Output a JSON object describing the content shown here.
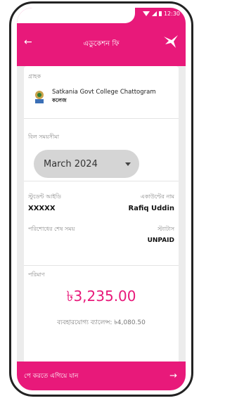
{
  "statusbar": {
    "time": "12:30"
  },
  "header": {
    "title": "এডুকেশন ফি",
    "back_icon": "arrow-left-icon",
    "logo_icon": "bird-logo-icon"
  },
  "institution": {
    "label": "গ্রাহক",
    "name": "Satkania Govt College Chattogram",
    "subname": "কলেজ"
  },
  "bill_period": {
    "label": "বিল সময়সীমা",
    "selected": "March 2024"
  },
  "student": {
    "id_label": "স্টুডেন্ট আইডি",
    "account_label": "একাউন্টের নাম",
    "id_value": "XXXXX",
    "account_value": "Rafiq Uddin",
    "deadline_label": "পরিশোধের শেষ সময়",
    "status_label": "স্ট্যাটাস",
    "status_value": "UNPAID"
  },
  "payment": {
    "label": "পরিমাণ",
    "amount": "৳3,235.00",
    "balance": "ব্যবহারযোগ্য ব্যালেন্স: ৳4,080.50"
  },
  "cta": {
    "label": "পে করতে এগিয়ে যান",
    "arrow": "→"
  },
  "colors": {
    "brand": "#e8197a",
    "card": "#ffffff",
    "bg": "#ececec"
  }
}
